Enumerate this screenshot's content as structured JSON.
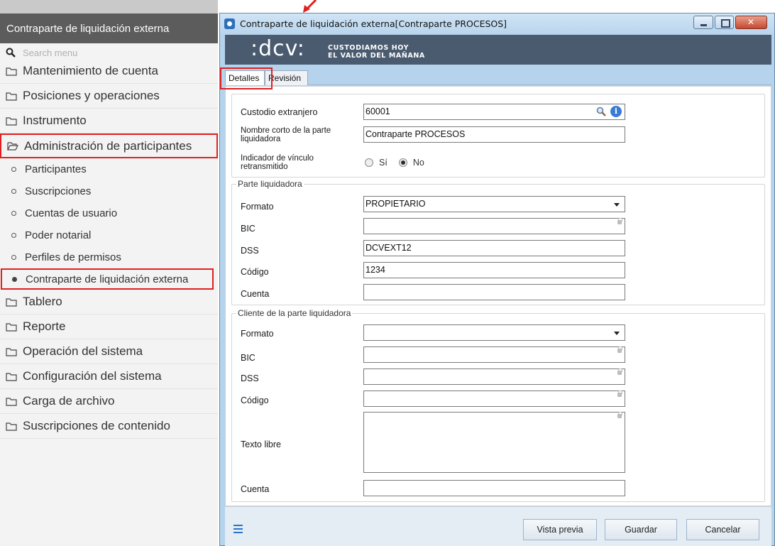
{
  "menu": {
    "header": "Contraparte de liquidación externa",
    "search_placeholder": "Search menu",
    "folders_top": [
      {
        "label": "Mantenimiento de cuenta"
      },
      {
        "label": "Posiciones y operaciones"
      },
      {
        "label": "Instrumento"
      }
    ],
    "open_folder": {
      "label": "Administración de participantes"
    },
    "sub_items": [
      {
        "label": "Participantes"
      },
      {
        "label": "Suscripciones"
      },
      {
        "label": "Cuentas de usuario"
      },
      {
        "label": "Poder notarial"
      },
      {
        "label": "Perfiles de permisos"
      },
      {
        "label": "Contraparte de liquidación externa",
        "active": true
      }
    ],
    "folders_bottom": [
      {
        "label": "Tablero"
      },
      {
        "label": "Reporte"
      },
      {
        "label": "Operación del sistema"
      },
      {
        "label": "Configuración del sistema"
      },
      {
        "label": "Carga de archivo"
      },
      {
        "label": "Suscripciones de contenido"
      }
    ]
  },
  "dialog": {
    "title": "Contraparte de liquidación externa[Contraparte PROCESOS]",
    "banner": {
      "logo": ":dcv:",
      "slogan_line1": "CUSTODIAMOS HOY",
      "slogan_line2": "EL VALOR DEL MAÑANA"
    },
    "tabs": [
      {
        "label": "Detalles",
        "selected": true
      },
      {
        "label": "Revisión",
        "selected": false
      }
    ],
    "form": {
      "custodio_label": "Custodio extranjero",
      "custodio_value": "60001",
      "nombre_label": "Nombre corto de la parte liquidadora",
      "nombre_value": "Contraparte PROCESOS",
      "indicador_label": "Indicador de vínculo retransmitido",
      "radio_si": "Sí",
      "radio_no": "No",
      "radio_selected": "No"
    },
    "parte_liquidadora": {
      "title": "Parte liquidadora",
      "formato_label": "Formato",
      "formato_value": "PROPIETARIO",
      "bic_label": "BIC",
      "bic_value": "",
      "dss_label": "DSS",
      "dss_value": "DCVEXT12",
      "codigo_label": "Código",
      "codigo_value": "1234",
      "cuenta_label": "Cuenta",
      "cuenta_value": ""
    },
    "cliente": {
      "title": "Cliente de la parte liquidadora",
      "formato_label": "Formato",
      "formato_value": "",
      "bic_label": "BIC",
      "dss_label": "DSS",
      "codigo_label": "Código",
      "texto_label": "Texto libre",
      "cuenta_label": "Cuenta"
    },
    "buttons": {
      "preview": "Vista previa",
      "save": "Guardar",
      "cancel": "Cancelar"
    }
  },
  "colors": {
    "highlight": "#e02020",
    "menu_header": "#5c5c5c",
    "banner": "#4a5b70",
    "window_frame": "#b5d3ec"
  }
}
